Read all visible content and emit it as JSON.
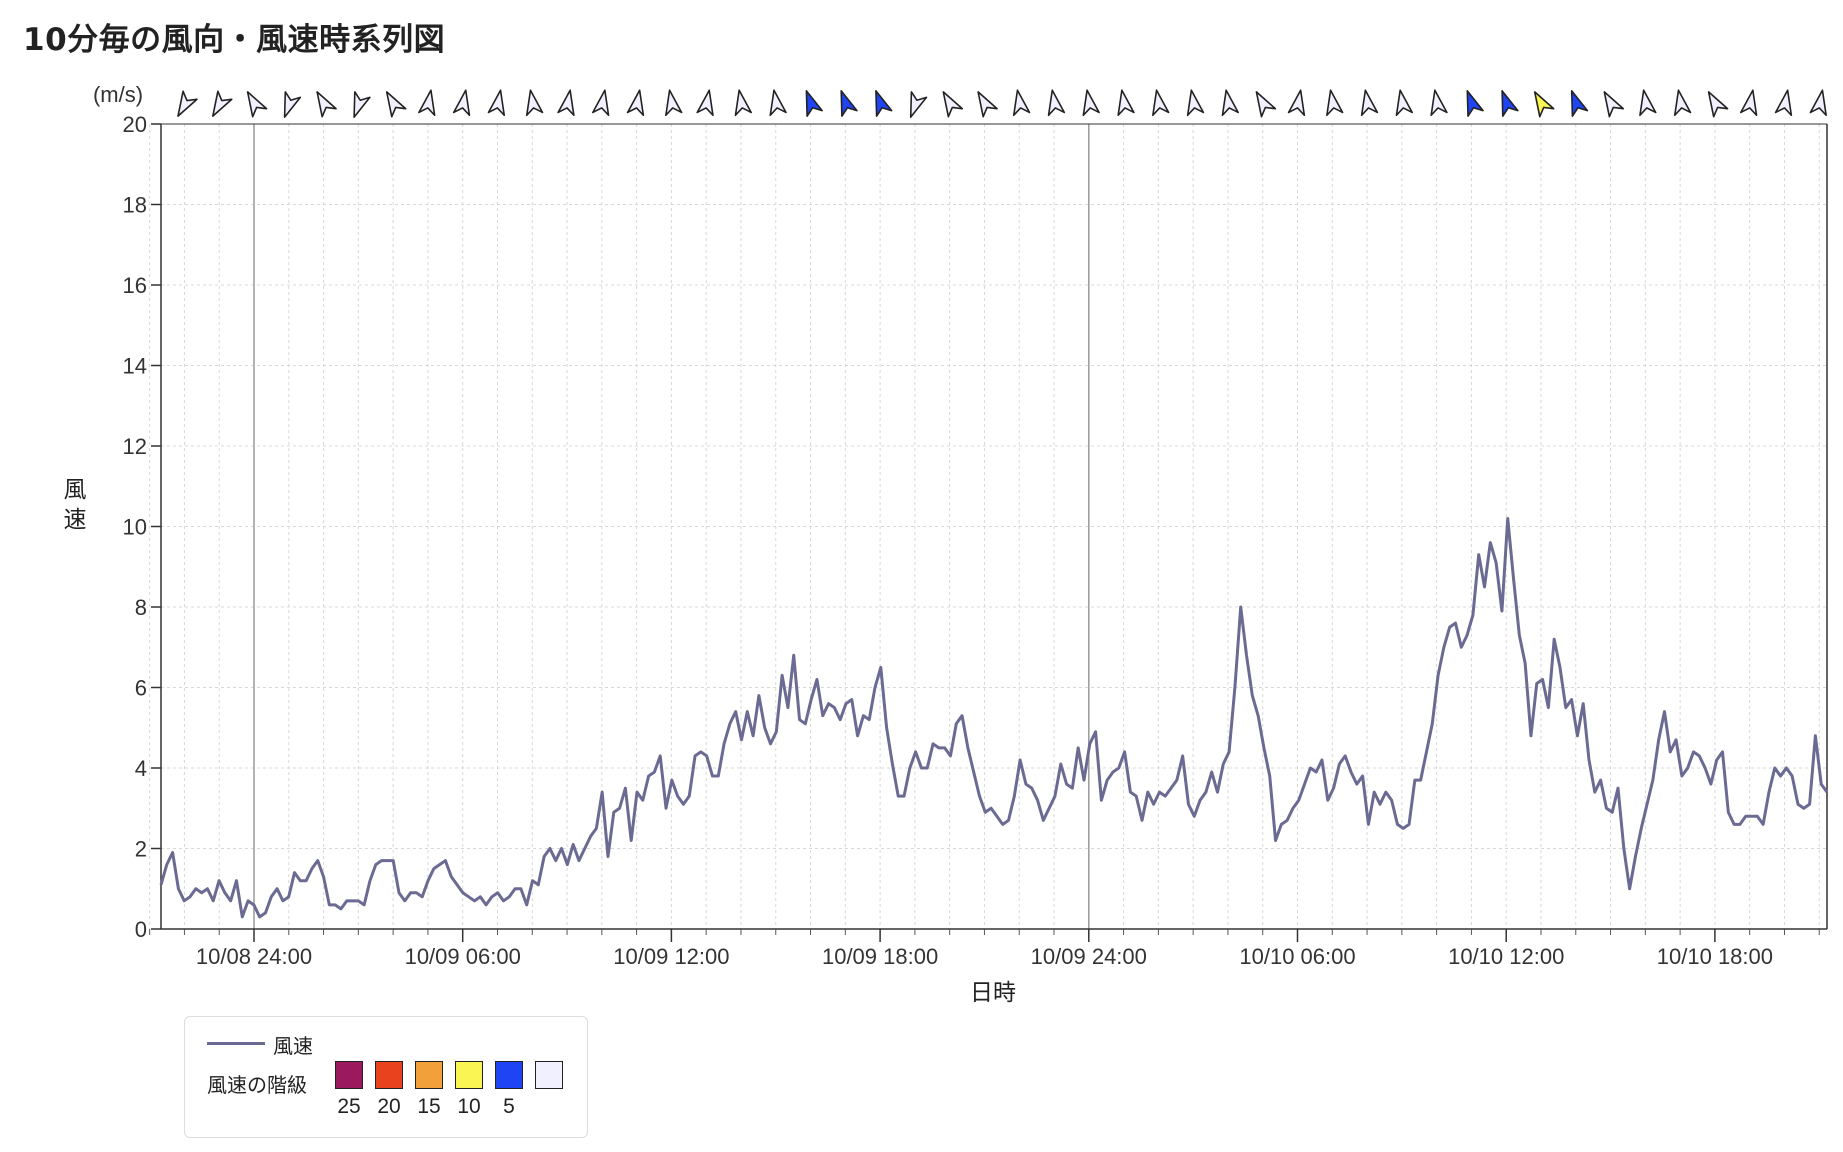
{
  "page": {
    "title": "10分毎の風向・風速時系列図"
  },
  "chart_data": {
    "type": "line",
    "y_unit": "(m/s)",
    "ylabel": "風速",
    "xlabel": "日時",
    "ylim": [
      0,
      20
    ],
    "y_ticks": [
      "0",
      "2",
      "4",
      "6",
      "8",
      "10",
      "12",
      "14",
      "16",
      "18",
      "20"
    ],
    "x_tick_labels": [
      "10/08 24:00",
      "10/09 06:00",
      "10/09 12:00",
      "10/09 18:00",
      "10/09 24:00",
      "10/10 06:00",
      "10/10 12:00",
      "10/10 18:00"
    ],
    "series": [
      {
        "name": "風速",
        "color": "#6b6a92",
        "values": [
          1.1,
          1.6,
          1.9,
          1.0,
          0.7,
          0.8,
          1.0,
          0.9,
          1.0,
          0.7,
          1.2,
          0.9,
          0.7,
          1.2,
          0.3,
          0.7,
          0.6,
          0.3,
          0.4,
          0.8,
          1.0,
          0.7,
          0.8,
          1.4,
          1.2,
          1.2,
          1.5,
          1.7,
          1.3,
          0.6,
          0.6,
          0.5,
          0.7,
          0.7,
          0.7,
          0.6,
          1.2,
          1.6,
          1.7,
          1.7,
          1.7,
          0.9,
          0.7,
          0.9,
          0.9,
          0.8,
          1.2,
          1.5,
          1.6,
          1.7,
          1.3,
          1.1,
          0.9,
          0.8,
          0.7,
          0.8,
          0.6,
          0.8,
          0.9,
          0.7,
          0.8,
          1.0,
          1.0,
          0.6,
          1.2,
          1.1,
          1.8,
          2.0,
          1.7,
          2.0,
          1.6,
          2.1,
          1.7,
          2.0,
          2.3,
          2.5,
          3.4,
          1.8,
          2.9,
          3.0,
          3.5,
          2.2,
          3.4,
          3.2,
          3.8,
          3.9,
          4.3,
          3.0,
          3.7,
          3.3,
          3.1,
          3.3,
          4.3,
          4.4,
          4.3,
          3.8,
          3.8,
          4.6,
          5.1,
          5.4,
          4.7,
          5.4,
          4.8,
          5.8,
          5.0,
          4.6,
          4.9,
          6.3,
          5.5,
          6.8,
          5.2,
          5.1,
          5.7,
          6.2,
          5.3,
          5.6,
          5.5,
          5.2,
          5.6,
          5.7,
          4.8,
          5.3,
          5.2,
          6.0,
          6.5,
          5.0,
          4.1,
          3.3,
          3.3,
          4.0,
          4.4,
          4.0,
          4.0,
          4.6,
          4.5,
          4.5,
          4.3,
          5.1,
          5.3,
          4.5,
          3.9,
          3.3,
          2.9,
          3.0,
          2.8,
          2.6,
          2.7,
          3.3,
          4.2,
          3.6,
          3.5,
          3.2,
          2.7,
          3.0,
          3.3,
          4.1,
          3.6,
          3.5,
          4.5,
          3.7,
          4.6,
          4.9,
          3.2,
          3.7,
          3.9,
          4.0,
          4.4,
          3.4,
          3.3,
          2.7,
          3.4,
          3.1,
          3.4,
          3.3,
          3.5,
          3.7,
          4.3,
          3.1,
          2.8,
          3.2,
          3.4,
          3.9,
          3.4,
          4.1,
          4.4,
          6.0,
          8.0,
          6.8,
          5.8,
          5.3,
          4.5,
          3.8,
          2.2,
          2.6,
          2.7,
          3.0,
          3.2,
          3.6,
          4.0,
          3.9,
          4.2,
          3.2,
          3.5,
          4.1,
          4.3,
          3.9,
          3.6,
          3.8,
          2.6,
          3.4,
          3.1,
          3.4,
          3.2,
          2.6,
          2.5,
          2.6,
          3.7,
          3.7,
          4.4,
          5.1,
          6.3,
          7.0,
          7.5,
          7.6,
          7.0,
          7.3,
          7.8,
          9.3,
          8.5,
          9.6,
          9.1,
          7.9,
          10.2,
          8.7,
          7.3,
          6.6,
          4.8,
          6.1,
          6.2,
          5.5,
          7.2,
          6.5,
          5.5,
          5.7,
          4.8,
          5.6,
          4.2,
          3.4,
          3.7,
          3.0,
          2.9,
          3.5,
          2.0,
          1.0,
          1.8,
          2.5,
          3.1,
          3.7,
          4.7,
          5.4,
          4.4,
          4.7,
          3.8,
          4.0,
          4.4,
          4.3,
          4.0,
          3.6,
          4.2,
          4.4,
          2.9,
          2.6,
          2.6,
          2.8,
          2.8,
          2.8,
          2.6,
          3.4,
          4.0,
          3.8,
          4.0,
          3.8,
          3.1,
          3.0,
          3.1,
          4.8,
          3.6,
          3.4
        ]
      }
    ],
    "wind_direction_arrows": [
      {
        "dir_deg": 210,
        "class": "<5"
      },
      {
        "dir_deg": 210,
        "class": "<5"
      },
      {
        "dir_deg": 330,
        "class": "<5"
      },
      {
        "dir_deg": 200,
        "class": "<5"
      },
      {
        "dir_deg": 330,
        "class": "<5"
      },
      {
        "dir_deg": 200,
        "class": "<5"
      },
      {
        "dir_deg": 330,
        "class": "<5"
      },
      {
        "dir_deg": 10,
        "class": "<5"
      },
      {
        "dir_deg": 10,
        "class": "<5"
      },
      {
        "dir_deg": 10,
        "class": "<5"
      },
      {
        "dir_deg": 350,
        "class": "<5"
      },
      {
        "dir_deg": 10,
        "class": "<5"
      },
      {
        "dir_deg": 10,
        "class": "<5"
      },
      {
        "dir_deg": 10,
        "class": "<5"
      },
      {
        "dir_deg": 350,
        "class": "<5"
      },
      {
        "dir_deg": 10,
        "class": "<5"
      },
      {
        "dir_deg": 350,
        "class": "<5"
      },
      {
        "dir_deg": 350,
        "class": "<5"
      },
      {
        "dir_deg": 340,
        "class": "5-10"
      },
      {
        "dir_deg": 340,
        "class": "5-10"
      },
      {
        "dir_deg": 340,
        "class": "5-10"
      },
      {
        "dir_deg": 200,
        "class": "<5"
      },
      {
        "dir_deg": 330,
        "class": "<5"
      },
      {
        "dir_deg": 330,
        "class": "<5"
      },
      {
        "dir_deg": 350,
        "class": "<5"
      },
      {
        "dir_deg": 350,
        "class": "<5"
      },
      {
        "dir_deg": 350,
        "class": "<5"
      },
      {
        "dir_deg": 350,
        "class": "<5"
      },
      {
        "dir_deg": 350,
        "class": "<5"
      },
      {
        "dir_deg": 350,
        "class": "<5"
      },
      {
        "dir_deg": 350,
        "class": "<5"
      },
      {
        "dir_deg": 330,
        "class": "<5"
      },
      {
        "dir_deg": 10,
        "class": "<5"
      },
      {
        "dir_deg": 350,
        "class": "<5"
      },
      {
        "dir_deg": 350,
        "class": "<5"
      },
      {
        "dir_deg": 350,
        "class": "<5"
      },
      {
        "dir_deg": 350,
        "class": "<5"
      },
      {
        "dir_deg": 340,
        "class": "5-10"
      },
      {
        "dir_deg": 340,
        "class": "5-10"
      },
      {
        "dir_deg": 330,
        "class": "10-15"
      },
      {
        "dir_deg": 340,
        "class": "5-10"
      },
      {
        "dir_deg": 330,
        "class": "<5"
      },
      {
        "dir_deg": 350,
        "class": "<5"
      },
      {
        "dir_deg": 350,
        "class": "<5"
      },
      {
        "dir_deg": 330,
        "class": "<5"
      },
      {
        "dir_deg": 10,
        "class": "<5"
      },
      {
        "dir_deg": 10,
        "class": "<5"
      },
      {
        "dir_deg": 10,
        "class": "<5"
      }
    ],
    "wind_speed_classes": [
      {
        "label": "25",
        "color": "#9b1a5f"
      },
      {
        "label": "20",
        "color": "#e8421f"
      },
      {
        "label": "15",
        "color": "#f2a03a"
      },
      {
        "label": "10",
        "color": "#fbf554"
      },
      {
        "label": "5",
        "color": "#1f44f4"
      },
      {
        "label": "",
        "color": "#f0f0ff"
      }
    ],
    "legend": {
      "series_label": "風速",
      "classes_label": "風速の階級"
    },
    "grid": true
  }
}
